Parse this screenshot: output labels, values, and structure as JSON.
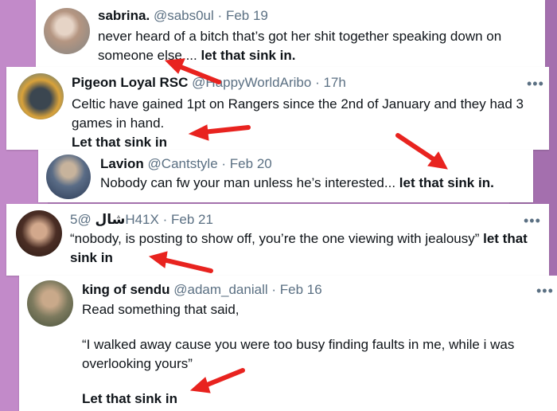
{
  "tweets": [
    {
      "name": "sabrina.",
      "handle": "@sabs0ul",
      "date": "Feb 19",
      "text": "never heard of a bitch that’s got her shit together speaking down on someone else....",
      "emphasis": "let that sink in."
    },
    {
      "name": "Pigeon Loyal RSC",
      "handle": "@HappyWorldAribo",
      "date": "17h",
      "text": "Celtic have gained 1pt on Rangers since the 2nd of January and they had 3 games in hand.",
      "emphasis": "Let that sink in",
      "more": "•••"
    },
    {
      "name": "Lavion",
      "handle": "@Cantstyle",
      "date": "Feb 20",
      "text": "Nobody can fw your man unless he’s interested...",
      "emphasis": "let that sink in."
    },
    {
      "name": "شال",
      "handle": "@5H41X",
      "date": "Feb 21",
      "text": "“nobody, is posting to show off, you’re the one viewing with jealousy”",
      "emphasis": "let that sink in",
      "more": "•••"
    },
    {
      "name": "king of sendu",
      "handle": "@adam_daniall",
      "date": "Feb 16",
      "line1": "Read something that said,",
      "line2": "“I walked away cause you were too busy finding faults in me, while i was overlooking yours”",
      "emphasis": "Let that sink in",
      "more": "•••"
    }
  ],
  "sep": "·",
  "colors": {
    "annotation_arrow": "#e8231f",
    "background": "#b07ab8"
  }
}
